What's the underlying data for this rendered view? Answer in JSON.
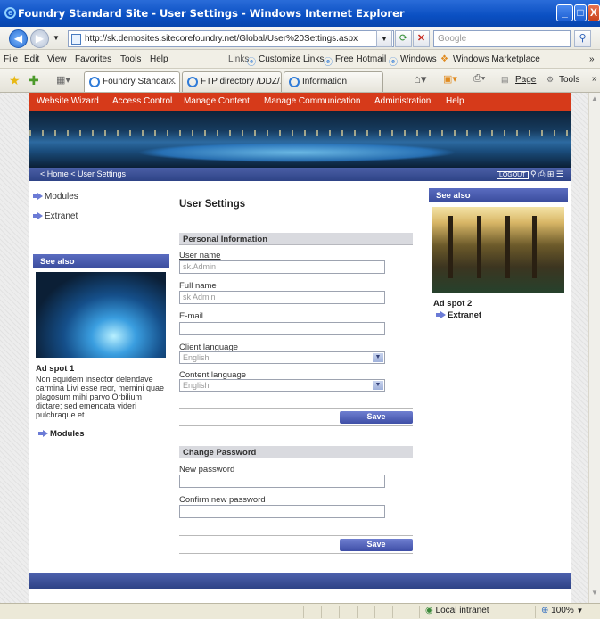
{
  "window": {
    "title": "Foundry Standard Site - User Settings - Windows Internet Explorer",
    "min": "_",
    "max": "□",
    "close": "X"
  },
  "address": {
    "url": "http://sk.demosites.sitecorefoundry.net/Global/User%20Settings.aspx",
    "search_placeholder": "Google"
  },
  "menu": {
    "items": [
      "File",
      "Edit",
      "View",
      "Favorites",
      "Tools",
      "Help"
    ],
    "links_label": "Links",
    "links": [
      "Customize Links",
      "Free Hotmail",
      "Windows",
      "Windows Marketplace"
    ]
  },
  "tabs": [
    {
      "label": "Foundry Standar..."
    },
    {
      "label": "FTP directory /DDZ/..."
    },
    {
      "label": "Information"
    }
  ],
  "toolbar": {
    "page": "Page",
    "tools": "Tools"
  },
  "site_nav": [
    "Website Wizard",
    "Access Control",
    "Manage Content",
    "Manage Communication",
    "Administration",
    "Help"
  ],
  "breadcrumb": "< Home < User Settings",
  "header_icons": {
    "logout": "LOGOUT"
  },
  "left": {
    "links": [
      "Modules",
      "Extranet"
    ],
    "see_also": "See also",
    "ad_title": "Ad spot 1",
    "ad_text": "Non equidem insector delendave carmina Livi esse reor, memini quae plagosum mihi parvo Orbilium dictare; sed emendata videri pulchraque et...",
    "ad_link": "Modules"
  },
  "main": {
    "title": "User Settings",
    "personal": {
      "heading": "Personal Information",
      "username_label": "User name",
      "username_value": "sk.Admin",
      "fullname_label": "Full name",
      "fullname_value": "sk Admin",
      "email_label": "E-mail",
      "email_value": "",
      "client_lang_label": "Client language",
      "client_lang_value": "English",
      "content_lang_label": "Content language",
      "content_lang_value": "English",
      "save": "Save"
    },
    "password": {
      "heading": "Change Password",
      "new_label": "New password",
      "confirm_label": "Confirm new password",
      "save": "Save"
    }
  },
  "right": {
    "see_also": "See also",
    "ad_title": "Ad spot 2",
    "ad_link": "Extranet"
  },
  "status": {
    "zone": "Local intranet",
    "zoom": "100%"
  }
}
